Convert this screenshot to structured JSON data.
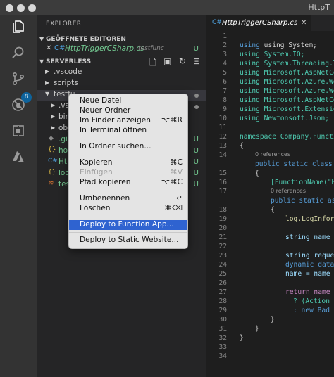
{
  "window": {
    "title": "HttpT"
  },
  "activity": {
    "badge": "8"
  },
  "explorer": {
    "title": "EXPLORER",
    "open_editors": {
      "header": "GEÖFFNETE EDITOREN",
      "file": "HttpTriggerCSharp.cs",
      "folder": "testfunc",
      "status": "U"
    },
    "workspace": {
      "header": "SERVERLESS",
      "items": [
        {
          "label": ".vscode",
          "status": ""
        },
        {
          "label": "scripts",
          "status": ""
        },
        {
          "label": "testfu",
          "status": ""
        },
        {
          "label": ".vs",
          "status": ""
        },
        {
          "label": "bin",
          "status": ""
        },
        {
          "label": "obj",
          "status": ""
        },
        {
          "label": ".git",
          "status": "U"
        },
        {
          "label": "hos",
          "status": "U"
        },
        {
          "label": "Htt",
          "status": "U"
        },
        {
          "label": "loc",
          "status": "U"
        },
        {
          "label": "tes",
          "status": "U"
        }
      ]
    }
  },
  "editor": {
    "tab": "HttpTriggerCSharp.cs",
    "line_numbers": [
      "1",
      "2",
      "3",
      "4",
      "5",
      "6",
      "7",
      "8",
      "9",
      "10",
      "11",
      "12",
      "13",
      "14",
      "15",
      "16",
      "17",
      "18",
      "19",
      "20",
      "21",
      "22",
      "23",
      "24",
      "25",
      "26",
      "27",
      "28",
      "29",
      "30",
      "31",
      "32",
      "33",
      "34"
    ],
    "lines": {
      "l2": "using System;",
      "l3": "using System.IO;",
      "l4": "using System.Threading.Ta",
      "l5": "using Microsoft.AspNetCor",
      "l6": "using Microsoft.Azure.Web",
      "l7": "using Microsoft.Azure.Web",
      "l8": "using Microsoft.AspNetCor",
      "l9": "using Microsoft.Extension",
      "l10": "using Newtonsoft.Json;",
      "l12": "namespace Company.Functio",
      "l13": "{",
      "l15": "public static class Ht",
      "l16": "{",
      "l17": "[FunctionName(\"Ht",
      "l18": "public static asy",
      "l19": "{",
      "l20": "log.LogInform",
      "l22": "string name =",
      "l24": "string reques",
      "l25": "dynamic data",
      "l26": "name = name ?",
      "l28": "return name !",
      "l29": "? (Action",
      "l30": ": new Bad",
      "l31": "}",
      "l32": "}",
      "l33": "}"
    },
    "ref_a": "0 references",
    "ref_b": "0 references"
  },
  "context_menu": {
    "items": [
      {
        "label": "Neue Datei",
        "shortcut": ""
      },
      {
        "label": "Neuer Ordner",
        "shortcut": ""
      },
      {
        "label": "Im Finder anzeigen",
        "shortcut": "⌥⌘R"
      },
      {
        "label": "In Terminal öffnen",
        "shortcut": ""
      },
      {
        "label": "In Ordner suchen...",
        "shortcut": ""
      },
      {
        "label": "Kopieren",
        "shortcut": "⌘C"
      },
      {
        "label": "Einfügen",
        "shortcut": "⌘V"
      },
      {
        "label": "Pfad kopieren",
        "shortcut": "⌥⌘C"
      },
      {
        "label": "Umbenennen",
        "shortcut": "↵"
      },
      {
        "label": "Löschen",
        "shortcut": "⌘⌫"
      },
      {
        "label": "Deploy to Function App...",
        "shortcut": ""
      },
      {
        "label": "Deploy to Static Website...",
        "shortcut": ""
      }
    ]
  },
  "colors": {
    "accent": "#2f63d0",
    "untracked": "#73c991",
    "activity_bar": "#333333",
    "sidebar": "#252526",
    "editor": "#1e1e1e"
  },
  "icons": [
    "files-icon",
    "search-icon",
    "source-control-icon",
    "debug-icon",
    "extensions-icon",
    "azure-icon",
    "new-file-icon",
    "new-folder-icon",
    "refresh-icon",
    "collapse-icon"
  ]
}
